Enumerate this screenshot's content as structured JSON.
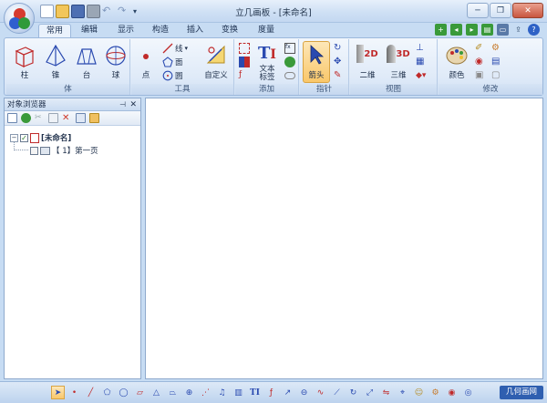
{
  "window": {
    "title": "立几画板 - [未命名]",
    "controls": {
      "minimize": "─",
      "restore": "❐",
      "close": "✕"
    }
  },
  "quick_access": [
    "new",
    "open",
    "save",
    "print",
    "undo",
    "redo",
    "customize"
  ],
  "ribbon_tabs": [
    {
      "label": "常用",
      "active": true
    },
    {
      "label": "编辑",
      "active": false
    },
    {
      "label": "显示",
      "active": false
    },
    {
      "label": "构造",
      "active": false
    },
    {
      "label": "插入",
      "active": false
    },
    {
      "label": "变换",
      "active": false
    },
    {
      "label": "度量",
      "active": false
    }
  ],
  "ribbon_groups": {
    "solid": {
      "label": "体",
      "buttons": [
        "柱",
        "锥",
        "台",
        "球"
      ]
    },
    "tools": {
      "label": "工具",
      "point": "点",
      "line": "线",
      "face": "面",
      "circle": "圆",
      "custom": "自定义"
    },
    "add": {
      "label": "添加",
      "text_label": "文本\n标签",
      "text_label_l1": "文本",
      "text_label_l2": "标签"
    },
    "pointer": {
      "label": "指针",
      "arrow": "箭头"
    },
    "view": {
      "label": "视图",
      "two_d": "二维",
      "three_d": "三维"
    },
    "modify": {
      "label": "修改",
      "color": "颜色"
    }
  },
  "panel": {
    "title": "对象浏览器",
    "tree": {
      "root": "[未命名]",
      "child": "【 1】第一页"
    }
  },
  "bottom": {
    "site_link": "几何画网"
  },
  "colors": {
    "accent": "#2f5fb0",
    "pointer_highlight": "#f9c76a"
  }
}
